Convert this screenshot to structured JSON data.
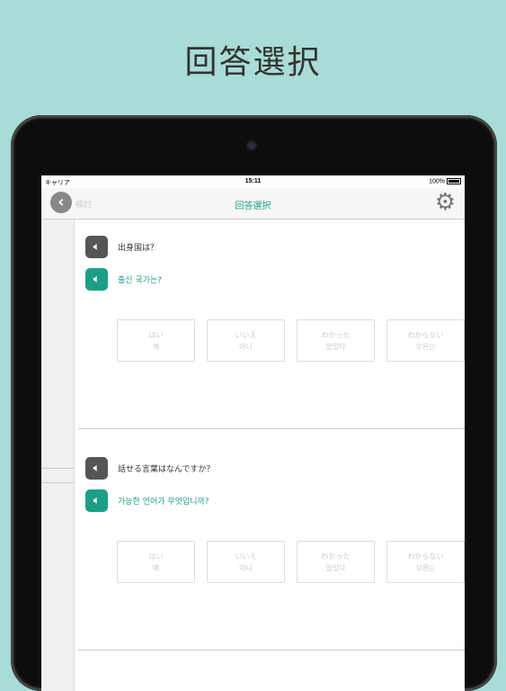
{
  "heading": "回答選択",
  "status": {
    "carrier": "キャリア",
    "time": "15:11",
    "battery": "100%"
  },
  "nav": {
    "title": "回答選択",
    "back_label": "検討"
  },
  "questions": [
    {
      "jp": "出身国は？",
      "ko": "출신 국가는?"
    },
    {
      "jp": "話せる言葉はなんですか？",
      "ko": "가능한 언어가 무엇입니까?"
    }
  ],
  "answers": [
    {
      "jp": "はい",
      "ko": "예"
    },
    {
      "jp": "いいえ",
      "ko": "아니"
    },
    {
      "jp": "わかった",
      "ko": "알았다"
    },
    {
      "jp": "わからない",
      "ko": "모른는"
    }
  ],
  "icons": {
    "back": "chevron-left-icon",
    "settings": "gear-icon",
    "speaker": "speaker-icon"
  },
  "colors": {
    "accent": "#1d9f85",
    "background": "#a9dcd6"
  }
}
